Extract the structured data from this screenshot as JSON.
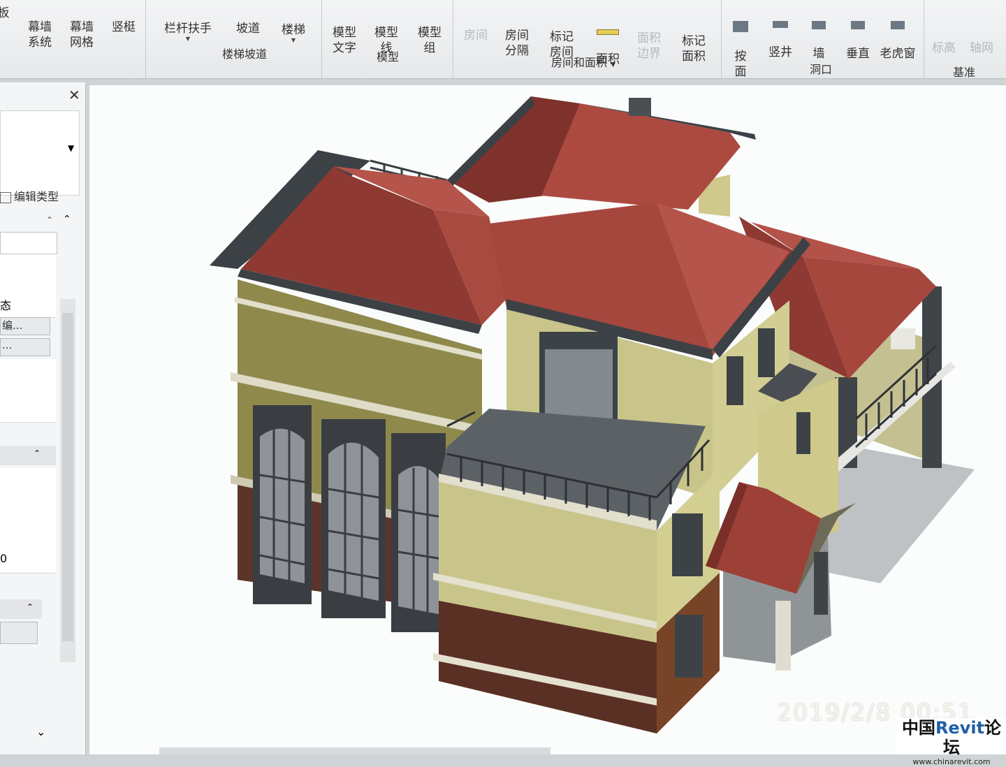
{
  "ribbon": {
    "tools": {
      "curtain_system": "幕墙\n系统",
      "curtain_grid": "幕墙\n网格",
      "mullion": "竖梃",
      "railing": "栏杆扶手",
      "ramp": "坡道",
      "stair": "楼梯",
      "model_text": "模型\n文字",
      "model_line": "模型\n线",
      "model_group": "模型\n组",
      "room": "房间",
      "room_separator": "房间\n分隔",
      "tag_room": "标记\n房间",
      "area": "面积",
      "area_boundary": "面积\n边界",
      "tag_area": "标记\n面积",
      "by_face": "按\n面",
      "shaft": "竖井",
      "wall_opening": "墙",
      "vertical": "垂直",
      "dormer": "老虎窗",
      "level": "标高",
      "grid": "轴网"
    },
    "groups": {
      "stairs_ramp": "楼梯坡道",
      "model": "模型",
      "room_area": "房间和面积",
      "opening": "洞口",
      "datum": "基准"
    },
    "partial_left": "板"
  },
  "panel": {
    "edit_type": "编辑类型",
    "state_fragment": "态",
    "ellipsis_1": "编...",
    "ellipsis_2": "...",
    "zero": "0"
  },
  "canvas": {
    "timestamp": "2019/2/8  00:51"
  },
  "watermark": {
    "title_left": "中国",
    "title_mid": "Revit",
    "title_right": "论坛",
    "url": "www.chinarevit.com"
  },
  "colors": {
    "roof": "#a2443b",
    "wall_upper": "#c9c58a",
    "wall_lower": "#5e3328",
    "trim": "#454a4f"
  }
}
